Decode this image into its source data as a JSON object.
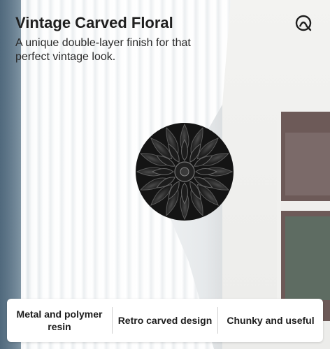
{
  "title": "Vintage Carved Floral",
  "subtitle": "A unique double-layer finish for that perfect vintage look.",
  "features": [
    "Metal and polymer resin",
    "Retro carved design",
    "Chunky and useful"
  ],
  "icons": {
    "logo": "brand-logo-icon",
    "product": "carved-flower-tieback"
  },
  "colors": {
    "text": "#1f1f1f",
    "card": "#ffffff",
    "product": "#1b1b1b"
  }
}
